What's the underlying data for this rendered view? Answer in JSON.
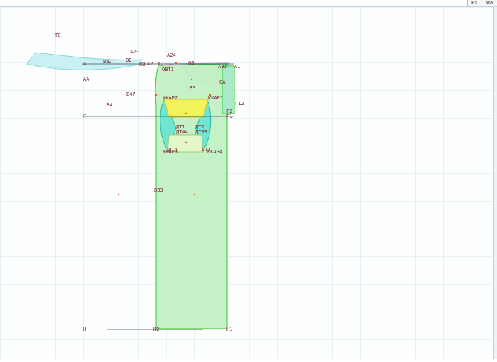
{
  "toolbar": {
    "tab_1": "Рз",
    "tab_2": "Ма"
  },
  "colors": {
    "grid": "#d3e4ea",
    "bodice_fill": "#bff0c0",
    "bodice_stroke": "#35c935",
    "collar_fill": "#c9f1f4",
    "neck_fill": "#f0e2f5",
    "yellow_fill": "#f2f25a",
    "label": "#7a2430",
    "point": "#e55a1a",
    "baseline": "#3b4a5a"
  },
  "labels": {
    "t0": "Т0",
    "a23": "А23",
    "a24": "А24",
    "a": "А",
    "bb2": "ВВ2",
    "bb": "ВВ",
    "a2": "А2",
    "a21": "А21",
    "ob": "ОВ",
    "ob1": "ОВТ1",
    "o2": "ОБ",
    "a31": "А31",
    "aa": "АА",
    "b3": "В3",
    "b47": "В47",
    "b4": "В4",
    "kkap2": "ККАР2",
    "kkap1": "ККАР1",
    "oa": "ОА",
    "a1": "А1",
    "g12": "Г12",
    "g": "Г",
    "g1": "Г1",
    "g2": "Г2",
    "dt1": "ДТ1",
    "dt2": "ДТ2",
    "dt44": "ДТ44",
    "dt33": "ДТ33",
    "dt4": "ДТ4",
    "dt3": "ДТ3",
    "kkap3": "ККАР3",
    "kkap4": "ККАР4",
    "bb3": "ВВ3",
    "n": "Н",
    "n2": "Н2",
    "n1": "Н1"
  }
}
